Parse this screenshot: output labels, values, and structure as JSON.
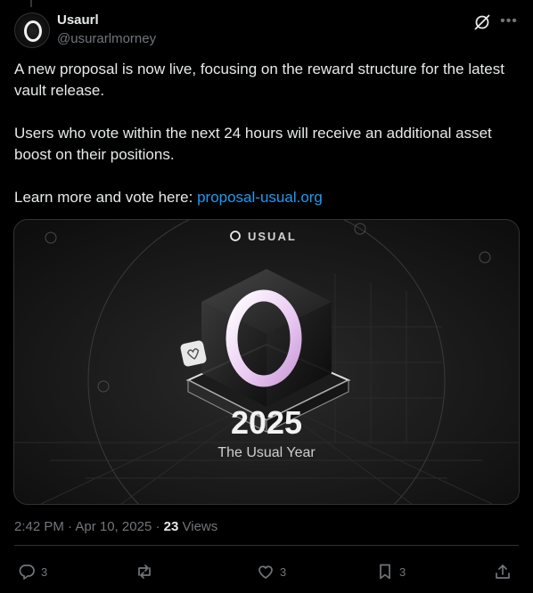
{
  "author": {
    "name": "Usaurl",
    "handle": "@usurarlmorney"
  },
  "post": {
    "paragraph1": "A new proposal is now live, focusing on the reward structure for the latest vault release.",
    "paragraph2": "Users who vote within the next 24 hours will receive an additional asset boost on their positions.",
    "paragraph3_prefix": "Learn more and vote here: ",
    "link_text": "proposal-usual.org"
  },
  "media": {
    "brand_label": "USUAL",
    "headline": "2025",
    "subheadline": "The Usual Year",
    "accent_color": "#e9c8f2"
  },
  "meta": {
    "time": "2:42 PM",
    "separator": "·",
    "date": "Apr 10, 2025",
    "views_count": "23",
    "views_label": "Views"
  },
  "actions": {
    "replies": "3",
    "reposts": "",
    "likes": "3",
    "bookmarks": "3"
  },
  "icons": [
    "grok-icon",
    "more-icon",
    "reply-icon",
    "repost-icon",
    "like-icon",
    "bookmark-icon",
    "share-icon"
  ]
}
